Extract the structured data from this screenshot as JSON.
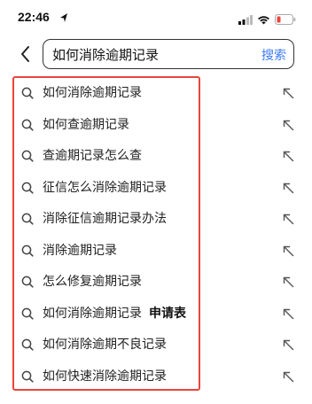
{
  "status_bar": {
    "time": "22:46",
    "icons": [
      "location-arrow-icon",
      "signal-icon",
      "wifi-icon",
      "battery-low-icon"
    ],
    "battery_color": "#e8453c"
  },
  "search": {
    "query": "如何消除逾期记录",
    "button_label": "搜索",
    "accent_color": "#3b7cf6"
  },
  "suggestions": [
    {
      "text": "如何消除逾期记录",
      "suffix": ""
    },
    {
      "text": "如何查逾期记录",
      "suffix": ""
    },
    {
      "text": "查逾期记录怎么查",
      "suffix": ""
    },
    {
      "text": "征信怎么消除逾期记录",
      "suffix": ""
    },
    {
      "text": "消除征信逾期记录办法",
      "suffix": ""
    },
    {
      "text": "消除逾期记录",
      "suffix": ""
    },
    {
      "text": "怎么修复逾期记录",
      "suffix": ""
    },
    {
      "text": "如何消除逾期记录",
      "suffix": "申请表"
    },
    {
      "text": "如何消除逾期不良记录",
      "suffix": ""
    },
    {
      "text": "如何快速消除逾期记录",
      "suffix": ""
    }
  ],
  "highlight_color": "#e8453c"
}
